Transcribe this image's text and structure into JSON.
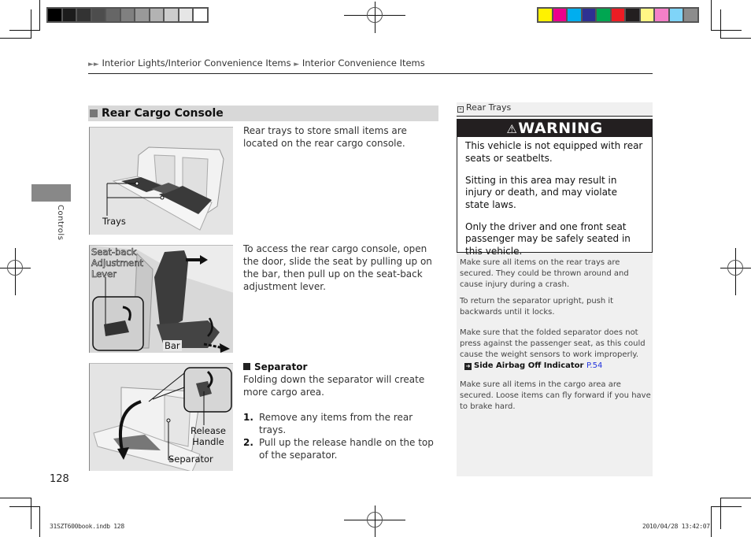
{
  "print_marks": {
    "grayscale_swatches": [
      "#000000",
      "#1c1c1c",
      "#333333",
      "#4d4d4d",
      "#666666",
      "#808080",
      "#999999",
      "#b3b3b3",
      "#cccccc",
      "#e6e6e6",
      "#ffffff"
    ],
    "color_swatches": [
      "#fff200",
      "#ec008c",
      "#00aeef",
      "#2e3192",
      "#00a651",
      "#ed1c24",
      "#231f20",
      "#fff685",
      "#f580c8",
      "#7fd4f8",
      "#8c8c8c"
    ]
  },
  "breadcrumb": {
    "marker": "►►",
    "parts": [
      "Interior Lights/Interior Convenience Items",
      "Interior Convenience Items"
    ],
    "separator": "►"
  },
  "side_tab": {
    "label": "Controls"
  },
  "section": {
    "title": "Rear Cargo Console",
    "figures": [
      {
        "labels": [
          "Trays"
        ]
      },
      {
        "labels": [
          "Seat-back",
          "Adjustment",
          "Lever",
          "Bar"
        ]
      },
      {
        "labels": [
          "Release",
          "Handle",
          "Separator"
        ]
      }
    ],
    "paragraph_1": "Rear trays to store small items are located on the rear cargo console.",
    "paragraph_2": "To access the rear cargo console, open the door, slide the seat by pulling up on the bar, then pull up on the seat-back adjustment lever.",
    "separator": {
      "heading": "Separator",
      "intro": "Folding down the separator will create more cargo area.",
      "steps": [
        {
          "num": "1.",
          "text": "Remove any items from the rear trays."
        },
        {
          "num": "2.",
          "text": "Pull up the release handle on the top of the separator."
        }
      ]
    }
  },
  "sidebar": {
    "ref_title": "Rear Trays",
    "warning": {
      "title": "WARNING",
      "paragraphs": [
        "This vehicle is not equipped with rear seats or seatbelts.",
        "Sitting in this area may result in injury or death, and may violate state laws.",
        "Only the driver and one front seat passenger may be safely seated in this vehicle."
      ]
    },
    "notes": [
      "Make sure all items on the rear trays are secured. They could be thrown around and cause injury during a crash.",
      "To return the separator upright, push it backwards until it locks.",
      "Make sure that the folded separator does not press against the passenger seat, as this could cause the weight sensors to work improperly.",
      "Make sure all items in the cargo area are secured. Loose items can fly forward if you have to brake hard."
    ],
    "xref": {
      "label": "Side Airbag Off Indicator",
      "page": "P.54"
    }
  },
  "footer": {
    "page_number": "128",
    "slug_left": "31SZT600book.indb   128",
    "slug_right": "2010/04/28   13:42:07"
  }
}
